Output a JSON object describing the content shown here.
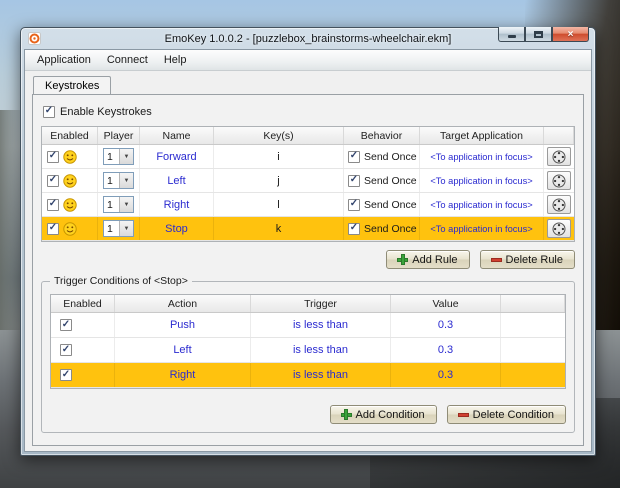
{
  "window": {
    "title": "EmoKey 1.0.0.2 - [puzzlebox_brainstorms-wheelchair.ekm]"
  },
  "menu": {
    "items": [
      "Application",
      "Connect",
      "Help"
    ]
  },
  "tabs": {
    "keystrokes": "Keystrokes"
  },
  "keystrokes_panel": {
    "enable_label": "Enable Keystrokes",
    "add_rule_label": "Add Rule",
    "delete_rule_label": "Delete Rule"
  },
  "rules_table": {
    "headers": [
      "Enabled",
      "Player",
      "Name",
      "Key(s)",
      "Behavior",
      "Target Application"
    ],
    "rows": [
      {
        "enabled": true,
        "player": "1",
        "name": "Forward",
        "keys": "i",
        "behavior": "Send Once",
        "target": "<To application in focus>",
        "highlighted": false
      },
      {
        "enabled": true,
        "player": "1",
        "name": "Left",
        "keys": "j",
        "behavior": "Send Once",
        "target": "<To application in focus>",
        "highlighted": false
      },
      {
        "enabled": true,
        "player": "1",
        "name": "Right",
        "keys": "l",
        "behavior": "Send Once",
        "target": "<To application in focus>",
        "highlighted": false
      },
      {
        "enabled": true,
        "player": "1",
        "name": "Stop",
        "keys": "k",
        "behavior": "Send Once",
        "target": "<To application in focus>",
        "highlighted": true
      }
    ]
  },
  "conditions_panel": {
    "group_title": "Trigger Conditions of <Stop>",
    "add_condition_label": "Add Condition",
    "delete_condition_label": "Delete Condition"
  },
  "conditions_table": {
    "headers": [
      "Enabled",
      "Action",
      "Trigger",
      "Value"
    ],
    "rows": [
      {
        "enabled": true,
        "action": "Push",
        "trigger": "is less than",
        "value": "0.3",
        "highlighted": false
      },
      {
        "enabled": true,
        "action": "Left",
        "trigger": "is less than",
        "value": "0.3",
        "highlighted": false
      },
      {
        "enabled": true,
        "action": "Right",
        "trigger": "is less than",
        "value": "0.3",
        "highlighted": true
      }
    ]
  },
  "colors": {
    "row_highlight": "#ffc20e",
    "link_blue": "#2b2bd0",
    "add_green": "#3aa53a",
    "delete_red": "#d04030",
    "close_button_red": "#ce4c2d"
  }
}
